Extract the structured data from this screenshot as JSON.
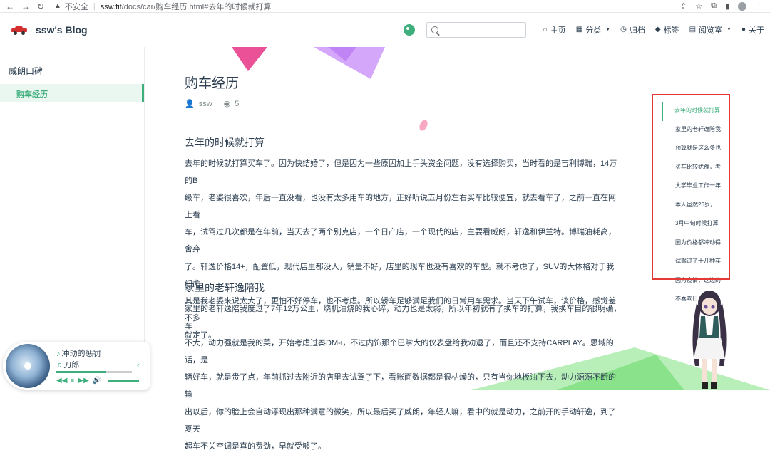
{
  "browser": {
    "security_label": "不安全",
    "host": "ssw.fit",
    "path": "/docs/car/购车经历.html#去年的时候就打算"
  },
  "navbar": {
    "brand_title": "ssw's Blog",
    "search_placeholder": "",
    "items": [
      {
        "label": "主页",
        "icon": "home-icon",
        "has_caret": false
      },
      {
        "label": "分类",
        "icon": "grid-icon",
        "has_caret": true
      },
      {
        "label": "归档",
        "icon": "clock-icon",
        "has_caret": false
      },
      {
        "label": "标签",
        "icon": "tag-icon",
        "has_caret": false
      },
      {
        "label": "阅览室",
        "icon": "book-icon",
        "has_caret": true
      },
      {
        "label": "关于",
        "icon": "user-icon",
        "has_caret": false
      }
    ]
  },
  "sidebar": {
    "group_title": "威朗口碑",
    "active_item": "购车经历"
  },
  "article": {
    "title": "购车经历",
    "author": "ssw",
    "views": "5",
    "sections": [
      {
        "heading": "去年的时候就打算",
        "lines": [
          "去年的时候就打算买车了。因为快结婚了，但是因为一些原因加上手头资金问题，没有选择购买，当时看的是吉利博瑞，14万的B",
          "级车，老婆很喜欢，年后一直没看，也没有太多用车的地方，正好听说五月份左右买车比较便宜，就去看车了，之前一直在网上看",
          "车，试驾过几次都是在年前，当天去了两个别克店，一个日产店，一个现代的店，主要看威朗，轩逸和伊兰特。博瑞油耗高，舍弃",
          "了。轩逸价格14+，配置低，现代店里都没人，销量不好，店里的现车也没有喜欢的车型。就不考虑了，SUV的大体格对于我们尤",
          "其是我老婆来说太大了，更怕不好停车，也不考虑。所以轿车足够满足我们的日常用车需求。当天下午试车，谈价格，感觉差不多",
          "就定了。"
        ]
      },
      {
        "heading": "家里的老轩逸陪我",
        "lines": [
          "家里的老轩逸陪我度过了7年12万公里，烧机油烧的我心碎，动力也是太弱，所以年初就有了换车的打算，我换车目的很明确，车",
          "不大，动力强就是我的菜，开始考虑过秦DM-i，不过内饰那个巴掌大的仪表盘给我劝退了，而且还不支持CARPLAY。思域的话，是",
          "辆好车，就是贵了点，年前抓过去附近的店里去试驾了下，看账面数据都是很枯燥的，只有当你地板油下去，动力源源不断的输",
          "出以后，你的脸上会自动浮现出那种满意的微笑，所以最后买了威朗，年轻人嘛，看中的就是动力，之前开的手动轩逸，到了夏天",
          "超车不关空调是真的费劲，早就受够了。"
        ]
      }
    ]
  },
  "toc": [
    "去年的时候就打算",
    "家里的老轩逸陪我",
    "预算就是这么多也",
    "买车比较犹豫，考",
    "大学毕业工作一年",
    "本人虽然26岁，",
    "3月中旬时候打算",
    "因为价格都冲动得",
    "试驾过了十几种车",
    "因为疫情，这边的",
    "不喜欢日"
  ],
  "player": {
    "song": "冲动的惩罚",
    "artist": "刀郎",
    "progress": 0.65
  },
  "colors": {
    "accent": "#3eaf7c",
    "highlight_box": "#e53935"
  }
}
